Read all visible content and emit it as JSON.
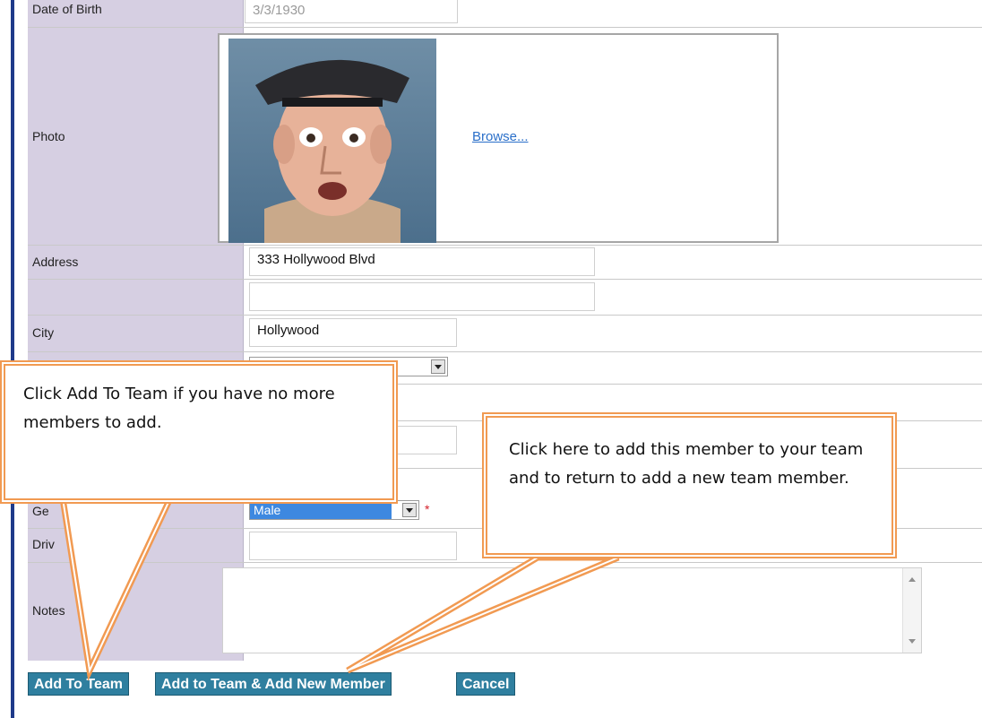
{
  "form": {
    "dob": {
      "label": "Date of Birth",
      "value": "3/3/1930"
    },
    "photo": {
      "label": "Photo",
      "browse_label": "Browse..."
    },
    "address": {
      "label": "Address",
      "value": "333 Hollywood Blvd",
      "value2": ""
    },
    "city": {
      "label": "City",
      "value": "Hollywood"
    },
    "gender": {
      "label": "Ge",
      "value": "Male"
    },
    "drivers": {
      "label": "Driv",
      "value": ""
    },
    "notes": {
      "label": "Notes",
      "value": ""
    }
  },
  "buttons": {
    "add_to_team": "Add To Team",
    "add_new_member": "Add to Team & Add New Member",
    "cancel": "Cancel"
  },
  "callouts": {
    "left": "Click Add To Team if you have no more members to add.",
    "right": "Click here to add this member to your team and to return to add a new team member."
  },
  "colors": {
    "label_bg": "#d6cfe2",
    "button_bg": "#2f7f9f",
    "callout_border": "#f19a52",
    "link": "#2a6fc9",
    "left_rule": "#1f3a8a"
  }
}
